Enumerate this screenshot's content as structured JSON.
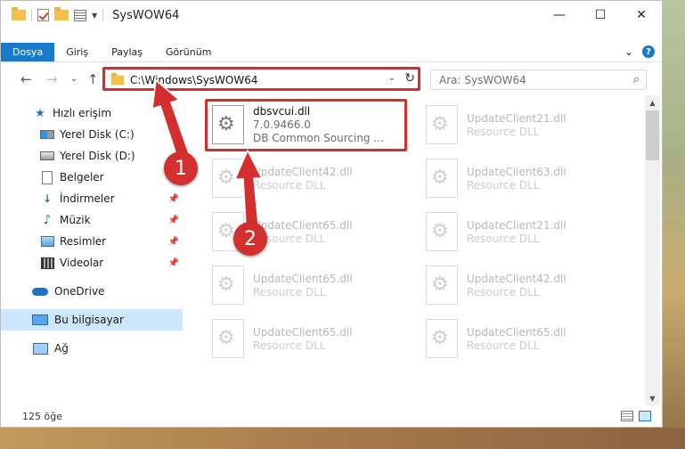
{
  "window": {
    "title": "SysWOW64",
    "controls": {
      "minimize": "—",
      "maximize": "☐",
      "close": "✕"
    }
  },
  "ribbon": {
    "tabs": [
      "Dosya",
      "Giriş",
      "Paylaş",
      "Görünüm"
    ],
    "expand_glyph": "⌄",
    "help_glyph": "?"
  },
  "navigation": {
    "back": "←",
    "forward": "→",
    "recent_glyph": "⌄",
    "up": "↑",
    "address": "C:\\Windows\\SysWOW64",
    "dropdown_glyph": "⌄",
    "refresh_glyph": "↻",
    "search_placeholder": "Ara: SysWOW64",
    "search_glyph": "⌕"
  },
  "sidebar": {
    "items": [
      {
        "label": "Hızlı erişim",
        "icon": "star-icon"
      },
      {
        "label": "Yerel Disk (C:)",
        "icon": "drive-icon"
      },
      {
        "label": "Yerel Disk (D:)",
        "icon": "drive-icon"
      },
      {
        "label": "Belgeler",
        "icon": "document-icon"
      },
      {
        "label": "İndirmeler",
        "icon": "download-icon",
        "pinned": true
      },
      {
        "label": "Müzik",
        "icon": "music-icon",
        "pinned": true
      },
      {
        "label": "Resimler",
        "icon": "pictures-icon",
        "pinned": true
      },
      {
        "label": "Videolar",
        "icon": "video-icon",
        "pinned": true
      },
      {
        "label": "OneDrive",
        "icon": "cloud-icon"
      },
      {
        "label": "Bu bilgisayar",
        "icon": "pc-icon",
        "selected": true
      },
      {
        "label": "Ağ",
        "icon": "network-icon"
      }
    ],
    "pin_glyph": "📌"
  },
  "files": [
    {
      "name": "dbsvcui.dll",
      "line1": "7.0.9466.0",
      "line2": "DB Common Sourcing ...",
      "highlighted": true
    },
    {
      "name": "UpdateClient21.dll",
      "line1": "Resource DLL"
    },
    {
      "name": "UpdateClient42.dll",
      "line1": "Resource DLL"
    },
    {
      "name": "UpdateClient63.dll",
      "line1": "Resource DLL"
    },
    {
      "name": "UpdateClient65.dll",
      "line1": "Resource DLL"
    },
    {
      "name": "UpdateClient21.dll",
      "line1": "Resource DLL"
    },
    {
      "name": "UpdateClient65.dll",
      "line1": "Resource DLL"
    },
    {
      "name": "UpdateClient42.dll",
      "line1": "Resource DLL"
    },
    {
      "name": "UpdateClient65.dll",
      "line1": "Resource DLL"
    },
    {
      "name": "UpdateClient65.dll",
      "line1": "Resource DLL"
    }
  ],
  "status": {
    "item_count": "125 öğe"
  },
  "annotations": {
    "callout_1": "1",
    "callout_2": "2",
    "accent": "#d32f2f"
  }
}
